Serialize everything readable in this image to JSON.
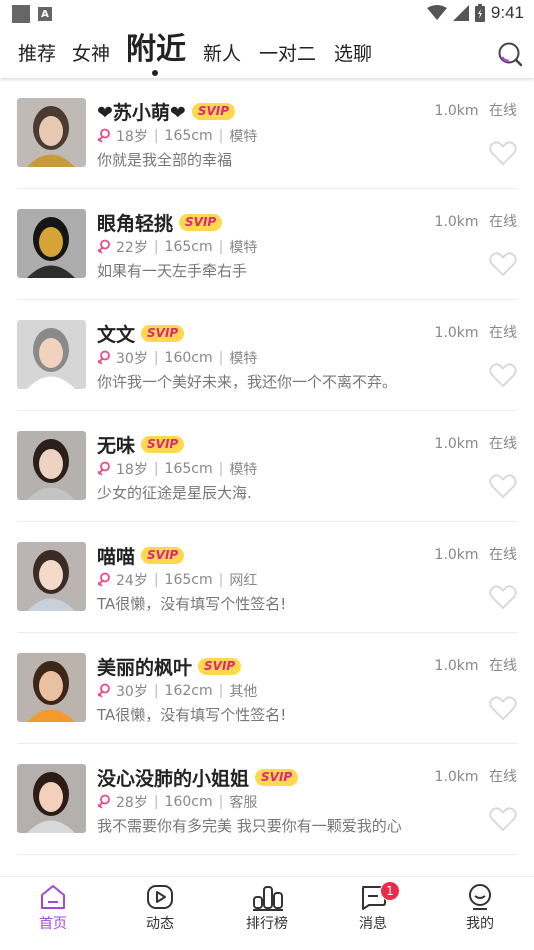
{
  "status_bar": {
    "time": "9:41",
    "notification_badge": "A"
  },
  "top_nav": {
    "tabs": [
      {
        "label": "推荐",
        "active": false
      },
      {
        "label": "女神",
        "active": false
      },
      {
        "label": "附近",
        "active": true
      },
      {
        "label": "新人",
        "active": false
      },
      {
        "label": "一对二",
        "active": false
      },
      {
        "label": "选聊",
        "active": false
      }
    ],
    "search_icon": "search-icon"
  },
  "users": [
    {
      "name": "❤苏小萌❤",
      "badge": "SVIP",
      "age": "18岁",
      "height": "165cm",
      "job": "模特",
      "signature": "你就是我全部的幸福",
      "distance": "1.0km",
      "status": "在线"
    },
    {
      "name": "眼角轻挑",
      "badge": "SVIP",
      "age": "22岁",
      "height": "165cm",
      "job": "模特",
      "signature": "如果有一天左手牵右手",
      "distance": "1.0km",
      "status": "在线"
    },
    {
      "name": "文文",
      "badge": "SVIP",
      "age": "30岁",
      "height": "160cm",
      "job": "模特",
      "signature": "你许我一个美好未来，我还你一个不离不弃。",
      "distance": "1.0km",
      "status": "在线"
    },
    {
      "name": "无味",
      "badge": "SVIP",
      "age": "18岁",
      "height": "165cm",
      "job": "模特",
      "signature": "少女的征途是星辰大海.",
      "distance": "1.0km",
      "status": "在线"
    },
    {
      "name": "喵喵",
      "badge": "SVIP",
      "age": "24岁",
      "height": "165cm",
      "job": "网红",
      "signature": "TA很懒，没有填写个性签名!",
      "distance": "1.0km",
      "status": "在线"
    },
    {
      "name": "美丽的枫叶",
      "badge": "SVIP",
      "age": "30岁",
      "height": "162cm",
      "job": "其他",
      "signature": "TA很懒，没有填写个性签名!",
      "distance": "1.0km",
      "status": "在线"
    },
    {
      "name": "没心没肺的小姐姐",
      "badge": "SVIP",
      "age": "28岁",
      "height": "160cm",
      "job": "客服",
      "signature": "我不需要你有多完美 我只要你有一颗爱我的心",
      "distance": "1.0km",
      "status": "在线"
    }
  ],
  "bottom_nav": {
    "items": [
      {
        "label": "首页",
        "icon": "home-icon",
        "active": true
      },
      {
        "label": "动态",
        "icon": "play-icon",
        "active": false
      },
      {
        "label": "排行榜",
        "icon": "ranking-icon",
        "active": false
      },
      {
        "label": "消息",
        "icon": "message-icon",
        "active": false,
        "badge": "1"
      },
      {
        "label": "我的",
        "icon": "profile-icon",
        "active": false
      }
    ]
  },
  "colors": {
    "accent": "#a347e0",
    "svip_bg": "#ffd84d",
    "svip_text": "#e0267a",
    "badge": "#f0284a"
  }
}
